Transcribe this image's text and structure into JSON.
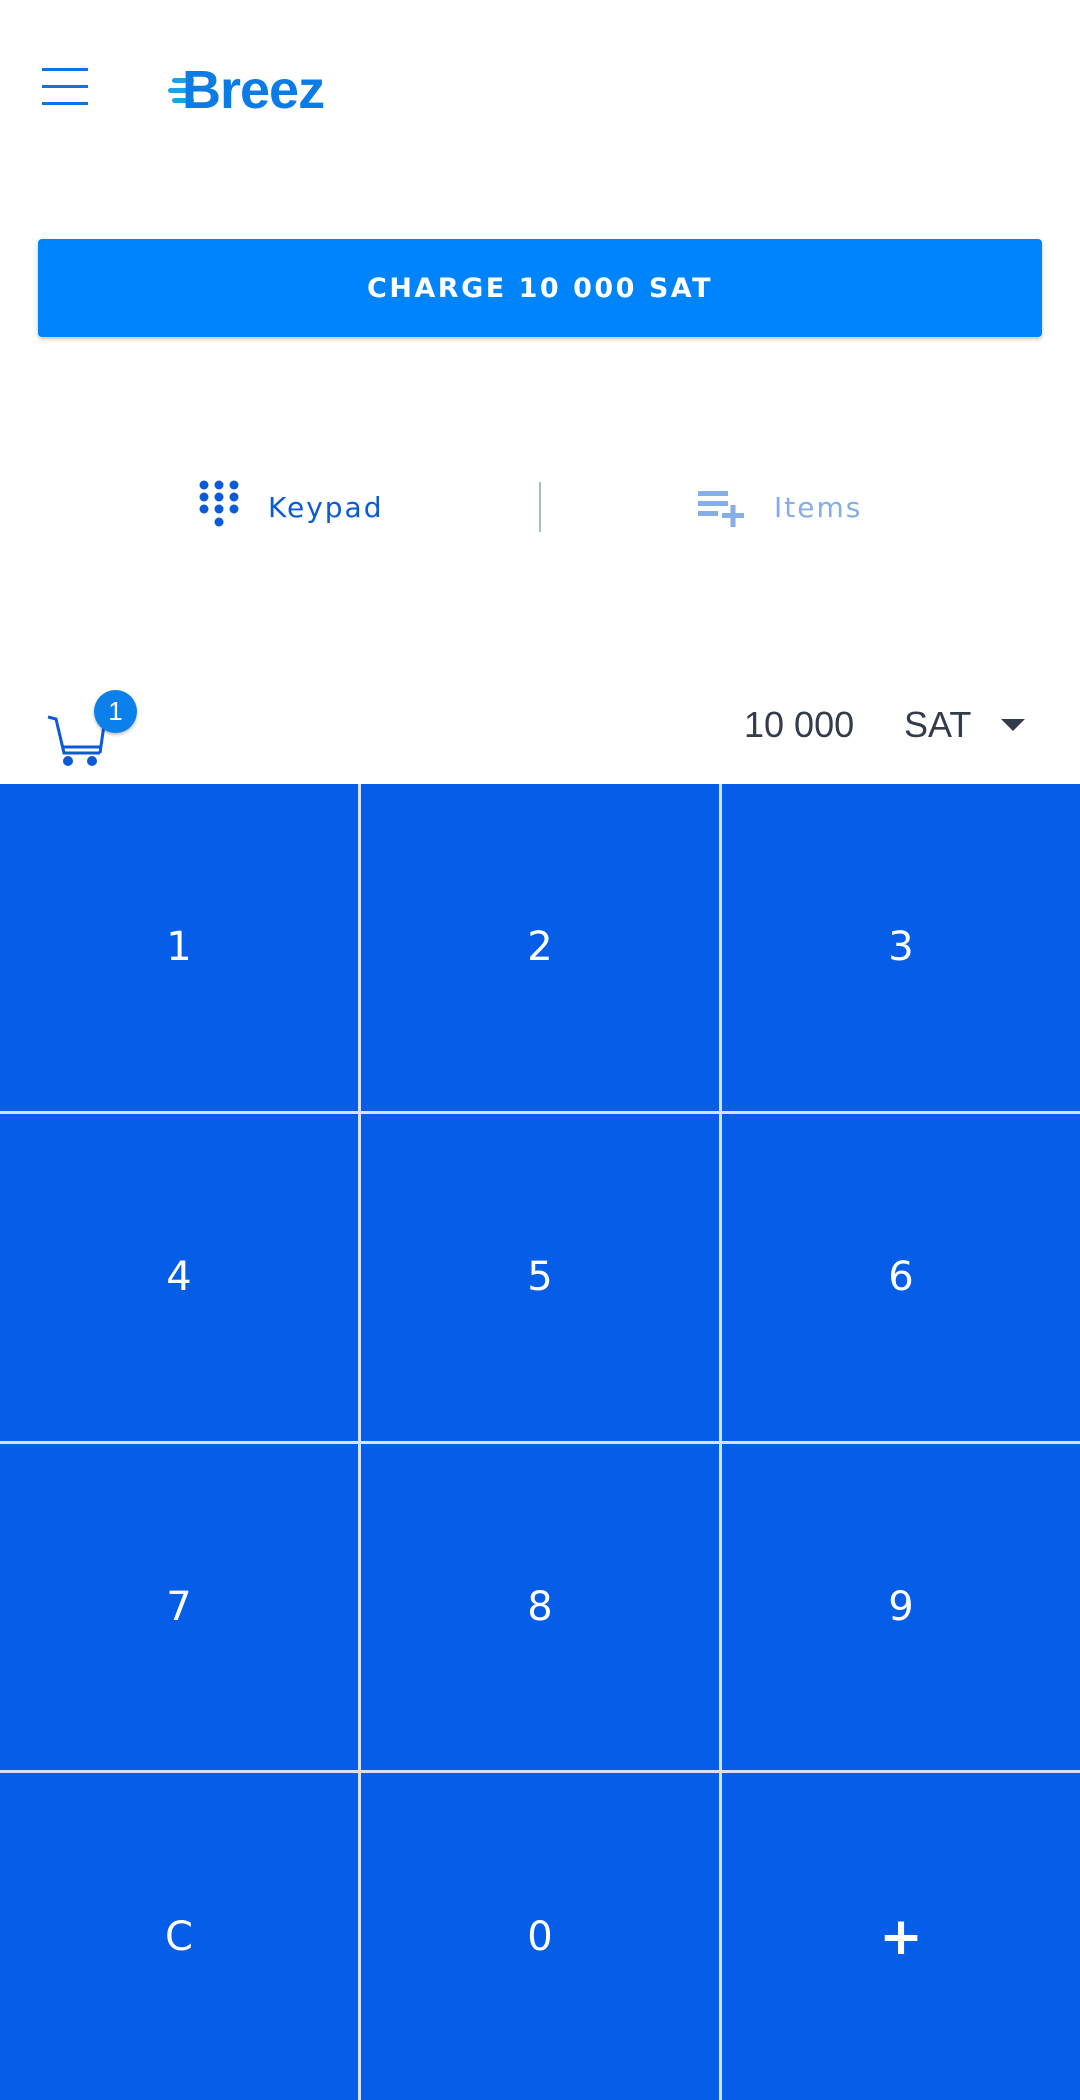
{
  "header": {
    "logo_text": "Breez",
    "menu_icon": "hamburger-menu-icon"
  },
  "charge_button": {
    "label": "CHARGE 10 000 SAT"
  },
  "tabs": [
    {
      "label": "Keypad",
      "icon": "dialpad-icon",
      "active": true
    },
    {
      "label": "Items",
      "icon": "playlist-add-icon",
      "active": false
    }
  ],
  "cart": {
    "count": "1",
    "icon": "cart-icon"
  },
  "amount": {
    "value": "10 000",
    "currency": "SAT"
  },
  "keypad": {
    "keys": [
      "1",
      "2",
      "3",
      "4",
      "5",
      "6",
      "7",
      "8",
      "9",
      "C",
      "0",
      "+"
    ]
  },
  "colors": {
    "primary": "#0084fb",
    "keypad": "#055de8",
    "active_tab": "#0b5ad8",
    "inactive_tab": "#86aee6"
  }
}
